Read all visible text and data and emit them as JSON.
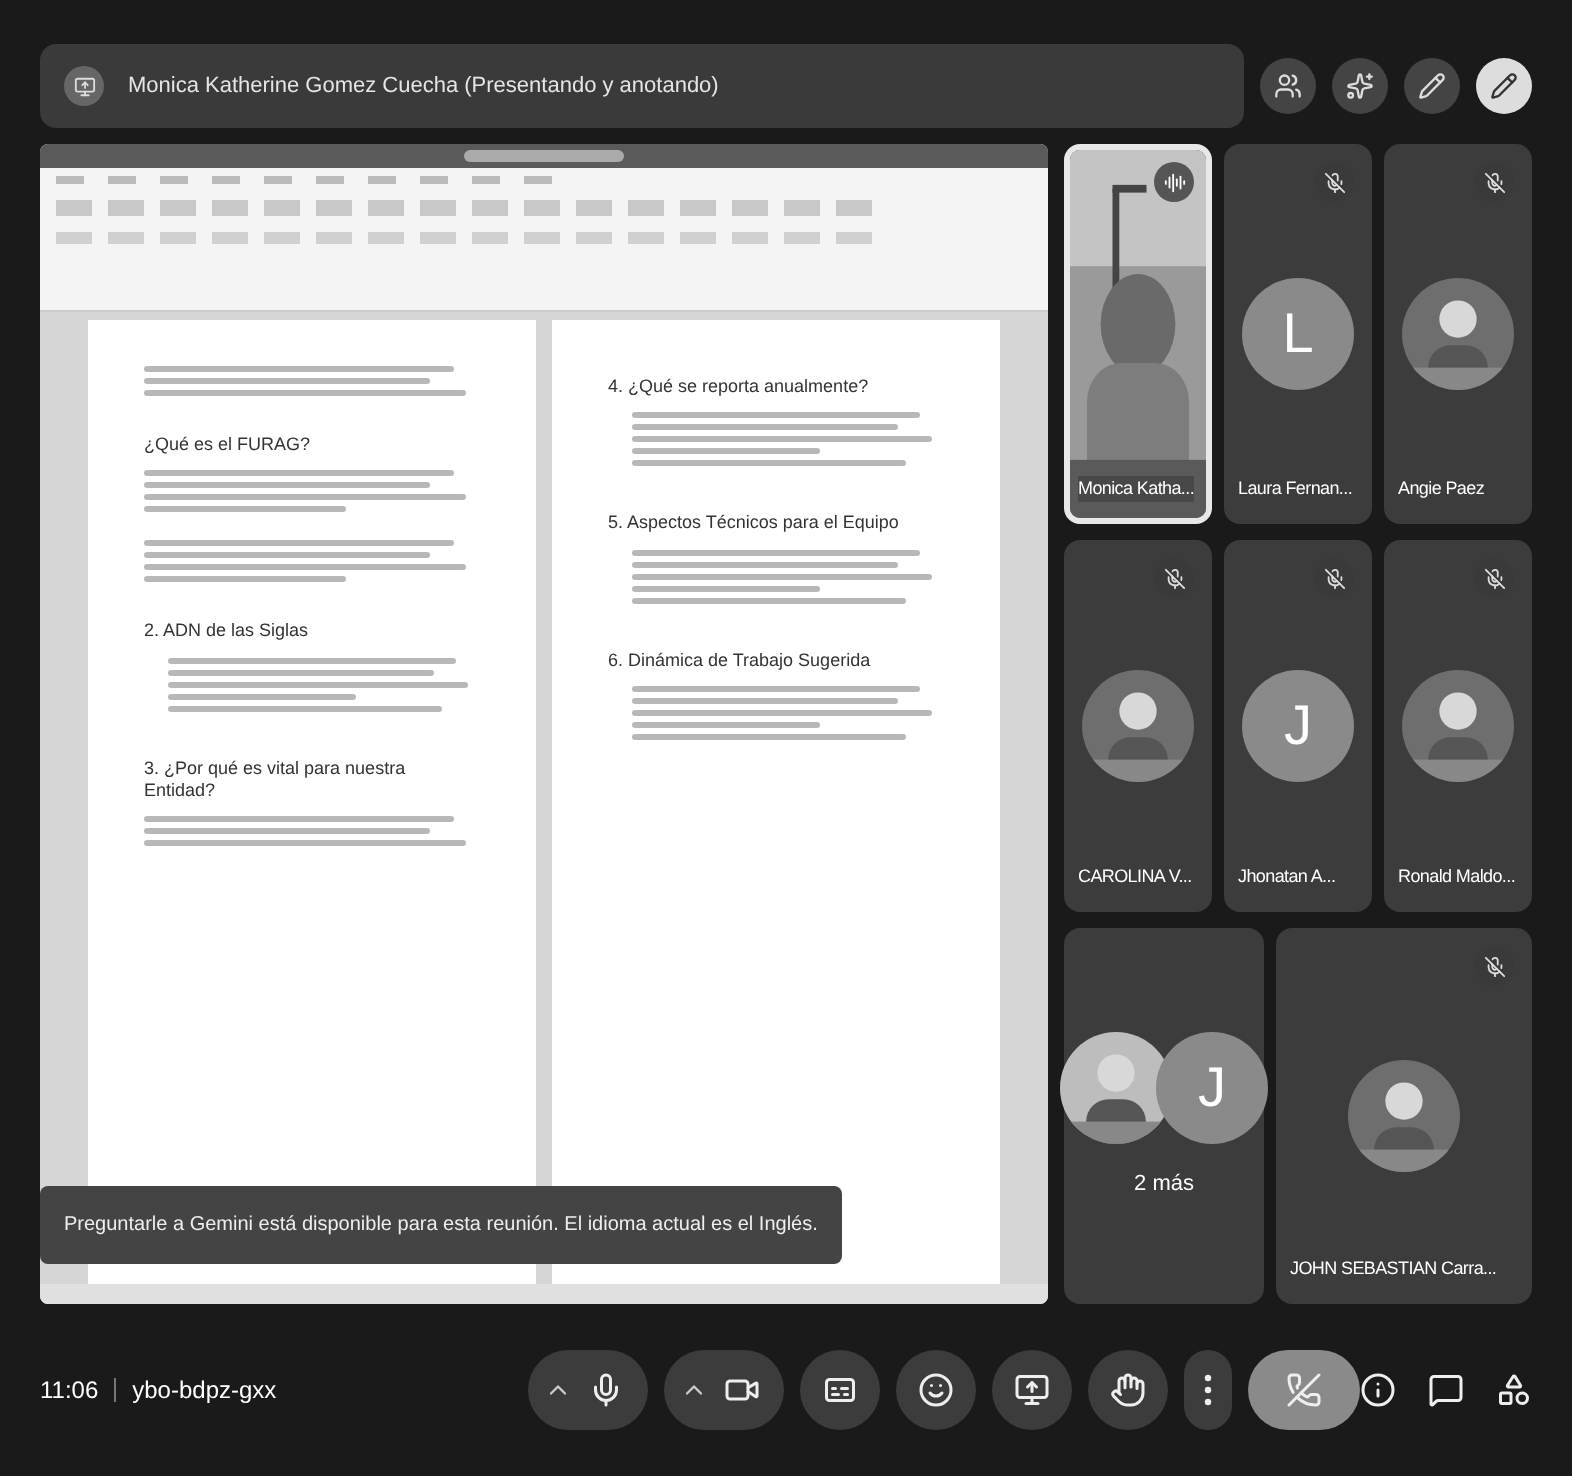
{
  "header": {
    "title": "Monica Katherine Gomez Cuecha (Presentando y anotando)"
  },
  "document": {
    "pages": [
      {
        "blocks": [
          {
            "kind": "lines"
          },
          {
            "kind": "heading",
            "text": "¿Qué es el FURAG?"
          },
          {
            "kind": "paragraph"
          },
          {
            "kind": "paragraph"
          },
          {
            "kind": "heading",
            "text": "2. ADN de las Siglas"
          },
          {
            "kind": "list"
          },
          {
            "kind": "heading",
            "text": "3. ¿Por qué es vital para nuestra Entidad?"
          },
          {
            "kind": "lines"
          }
        ]
      },
      {
        "blocks": [
          {
            "kind": "heading",
            "text": "4. ¿Qué se reporta anualmente?"
          },
          {
            "kind": "list"
          },
          {
            "kind": "heading",
            "text": "5. Aspectos Técnicos para el Equipo"
          },
          {
            "kind": "list"
          },
          {
            "kind": "heading",
            "text": "6. Dinámica de Trabajo Sugerida"
          },
          {
            "kind": "list"
          }
        ]
      }
    ]
  },
  "toast": {
    "text": "Preguntarle a Gemini está disponible para esta reunión. El idioma actual es el Inglés."
  },
  "participants": [
    {
      "name": "Monica Katha...",
      "kind": "video",
      "speaking": true,
      "muted": false
    },
    {
      "name": "Laura Fernan...",
      "kind": "initial",
      "initial": "L",
      "speaking": false,
      "muted": true
    },
    {
      "name": "Angie Paez",
      "speaking": false,
      "muted": true
    },
    {
      "name": "CAROLINA V...",
      "speaking": false,
      "muted": true
    },
    {
      "name": "Jhonatan A...",
      "kind": "initial",
      "initial": "J",
      "speaking": false,
      "muted": true
    },
    {
      "name": "Ronald Maldo...",
      "speaking": false,
      "muted": true
    }
  ],
  "others": {
    "label": "2 más",
    "initial": "J"
  },
  "last_participant": {
    "name": "JOHN SEBASTIAN Carra...",
    "speaking": false,
    "muted": true
  },
  "footer": {
    "time": "11:06",
    "meeting_code": "ybo-bdpz-gxx"
  },
  "controls": [
    {
      "kind": "mic"
    },
    {
      "kind": "camera"
    },
    {
      "kind": "captions"
    },
    {
      "kind": "emoji"
    },
    {
      "kind": "present"
    },
    {
      "kind": "hand"
    },
    {
      "kind": "more"
    },
    {
      "kind": "end"
    }
  ]
}
